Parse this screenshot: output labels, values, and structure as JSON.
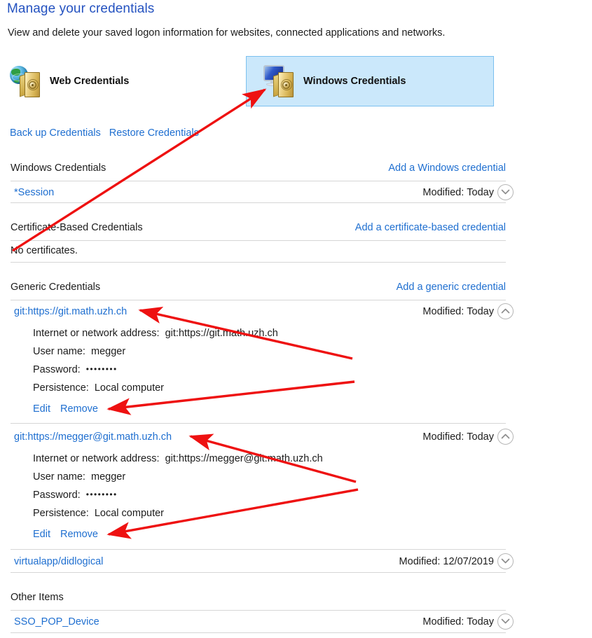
{
  "header": {
    "title": "Manage your credentials",
    "subtitle": "View and delete your saved logon information for websites, connected applications and networks."
  },
  "tiles": [
    {
      "label": "Web Credentials",
      "icon": "globe-vault-icon",
      "selected": false
    },
    {
      "label": "Windows Credentials",
      "icon": "monitor-vault-icon",
      "selected": true
    }
  ],
  "toolbar": {
    "backup_label": "Back up Credentials",
    "restore_label": "Restore Credentials"
  },
  "sections": [
    {
      "title": "Windows Credentials",
      "action": "Add a Windows credential",
      "rows": [
        {
          "name": "*Session",
          "modified_label": "Modified:",
          "modified_value": "Today",
          "expanded": false
        }
      ]
    },
    {
      "title": "Certificate-Based Credentials",
      "action": "Add a certificate-based credential",
      "empty_text": "No certificates."
    },
    {
      "title": "Generic Credentials",
      "action": "Add a generic credential",
      "rows": [
        {
          "name": "git:https://git.math.uzh.ch",
          "modified_label": "Modified:",
          "modified_value": "Today",
          "expanded": true,
          "details": {
            "address_label": "Internet or network address:",
            "address_value": "git:https://git.math.uzh.ch",
            "username_label": "User name:",
            "username_value": "megger",
            "password_label": "Password:",
            "password_value": "••••••••",
            "persistence_label": "Persistence:",
            "persistence_value": "Local computer",
            "edit_label": "Edit",
            "remove_label": "Remove"
          }
        },
        {
          "name": "git:https://megger@git.math.uzh.ch",
          "modified_label": "Modified:",
          "modified_value": "Today",
          "expanded": true,
          "details": {
            "address_label": "Internet or network address:",
            "address_value": "git:https://megger@git.math.uzh.ch",
            "username_label": "User name:",
            "username_value": "megger",
            "password_label": "Password:",
            "password_value": "••••••••",
            "persistence_label": "Persistence:",
            "persistence_value": "Local computer",
            "edit_label": "Edit",
            "remove_label": "Remove"
          }
        },
        {
          "name": "virtualapp/didlogical",
          "modified_label": "Modified:",
          "modified_value": "12/07/2019",
          "expanded": false
        }
      ]
    },
    {
      "title": "Other Items",
      "action": "",
      "rows": [
        {
          "name": "SSO_POP_Device",
          "modified_label": "Modified:",
          "modified_value": "Today",
          "expanded": false
        }
      ]
    }
  ],
  "colors": {
    "title_blue": "#2452c0",
    "link_blue": "#1f6fd0",
    "selected_tile_bg": "#cbe8fb",
    "selected_tile_border": "#7bc0ef",
    "rule": "#d6d6d6",
    "annotation_red": "#ee1111"
  }
}
